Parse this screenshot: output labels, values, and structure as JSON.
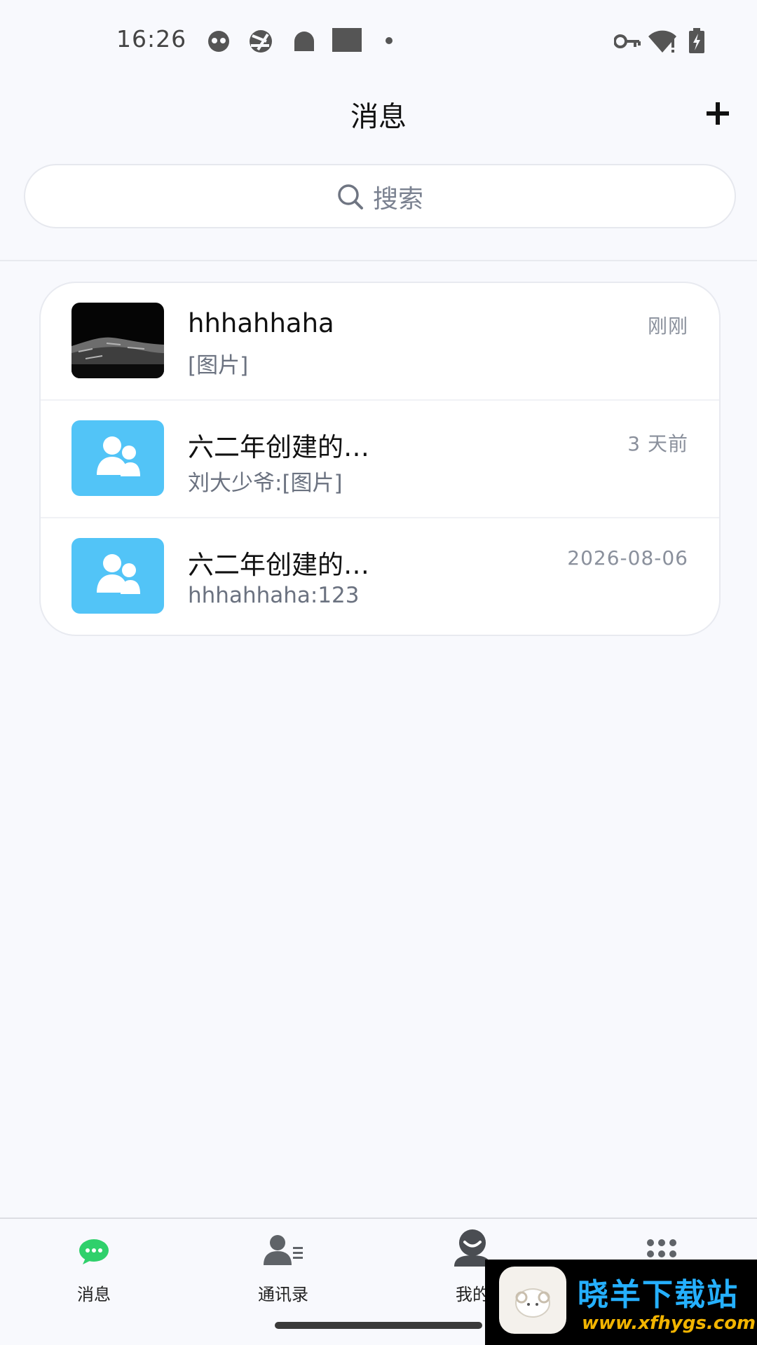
{
  "status_bar": {
    "time": "16:26",
    "left_icons": [
      "cat-icon",
      "aperture-icon",
      "android-icon",
      "square-icon",
      "dot-icon"
    ],
    "right_icons": [
      "vpn-key-icon",
      "wifi-alert-icon",
      "battery-charging-icon"
    ]
  },
  "header": {
    "title": "消息",
    "add_icon": "plus-icon"
  },
  "search": {
    "placeholder": "搜索",
    "icon": "search-icon"
  },
  "conversations": [
    {
      "name": "hhhahhaha",
      "preview": "[图片]",
      "time": "刚刚",
      "avatar": "photo"
    },
    {
      "name": "六二年创建的…",
      "preview": "刘大少爷:[图片]",
      "time": "3 天前",
      "avatar": "group"
    },
    {
      "name": "六二年创建的…",
      "preview": "hhhahhaha:123",
      "time": "2026-08-06",
      "avatar": "group"
    }
  ],
  "tabs": [
    {
      "label": "消息",
      "icon": "chat-bubble-icon",
      "active": true
    },
    {
      "label": "通讯录",
      "icon": "contacts-icon",
      "active": false
    },
    {
      "label": "我的",
      "icon": "profile-icon",
      "active": false
    },
    {
      "label": "",
      "icon": "apps-grid-icon",
      "active": false
    }
  ],
  "colors": {
    "background": "#f8f9fd",
    "group_avatar": "#52c4f7",
    "active_tab": "#2fd06b"
  },
  "watermark": {
    "title": "晓羊下载站",
    "url": "www.xfhygs.com"
  }
}
